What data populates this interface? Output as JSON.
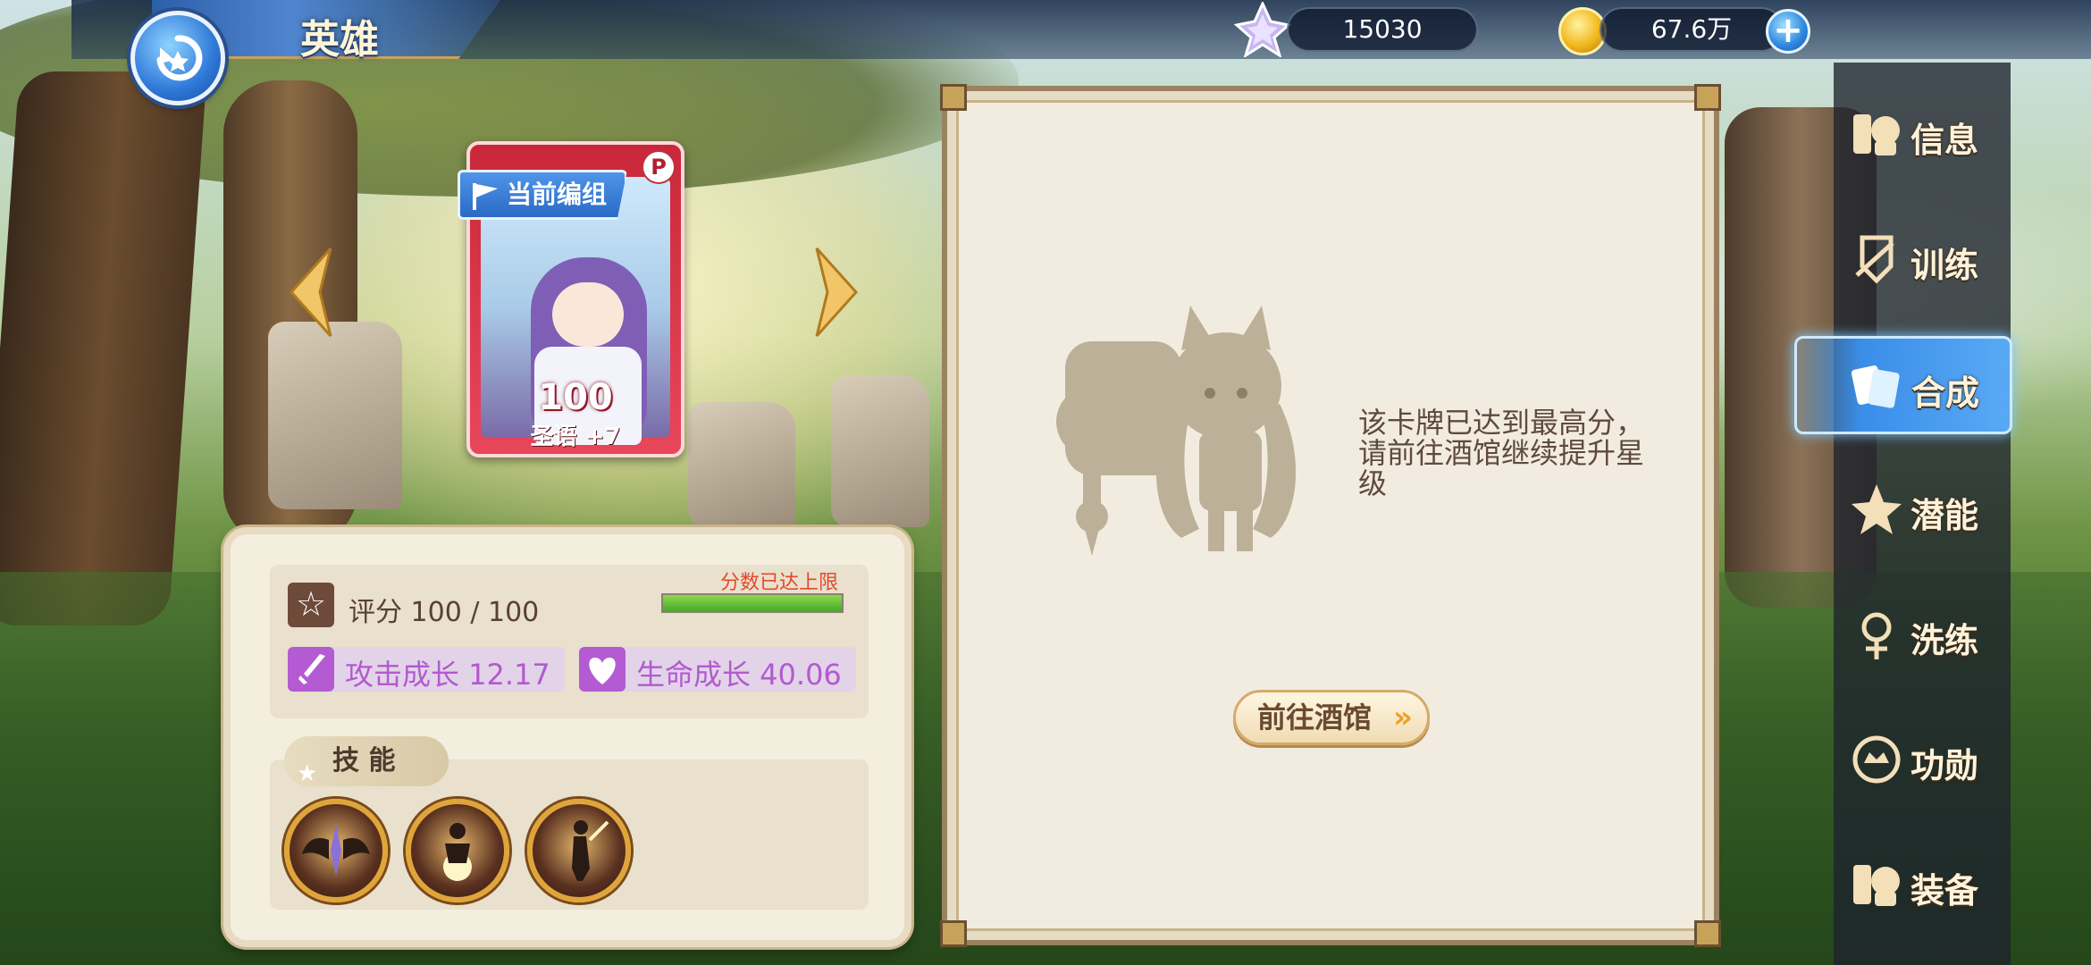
{
  "header": {
    "title": "英雄",
    "gems": "15030",
    "gold": "67.6万"
  },
  "card": {
    "team_tag": "当前编组",
    "score": "100",
    "name": "圣语 +7"
  },
  "stats": {
    "score_label": "评分 100 / 100",
    "limit_text": "分数已达上限",
    "score_progress": 1.0,
    "attack_growth": "攻击成长  12.17",
    "life_growth": "生命成长  40.06"
  },
  "skills": {
    "tab_label": "技 能",
    "icons": [
      "wings-icon",
      "meditation-icon",
      "swordsman-icon"
    ]
  },
  "info": {
    "message": "该卡牌已达到最高分，请前往酒馆继续提升星级",
    "button_label": "前往酒馆"
  },
  "menu": {
    "items": [
      {
        "label": "信息",
        "icon": "info-icon"
      },
      {
        "label": "训练",
        "icon": "training-icon"
      },
      {
        "label": "合成",
        "icon": "synthesis-icon",
        "active": true
      },
      {
        "label": "潜能",
        "icon": "potential-icon"
      },
      {
        "label": "洗练",
        "icon": "refine-icon"
      },
      {
        "label": "功勋",
        "icon": "merit-icon"
      },
      {
        "label": "装备",
        "icon": "equipment-icon"
      }
    ]
  },
  "colors": {
    "accent_blue": "#3a8ee8",
    "limit_red": "#e24a2a",
    "growth_purple": "#b25ad0",
    "progress_green": "#4aa82a"
  }
}
